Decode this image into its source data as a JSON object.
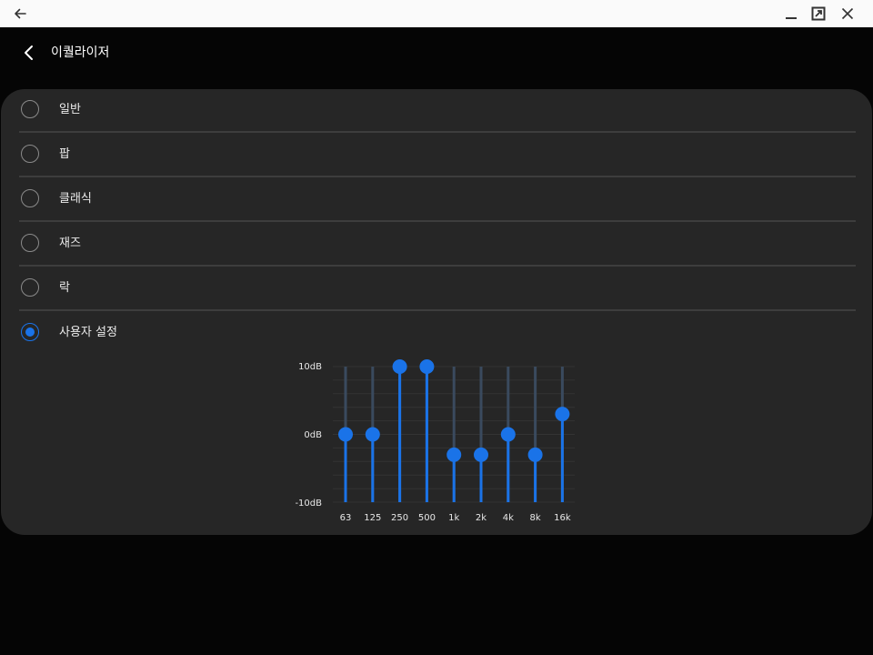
{
  "window": {
    "back_icon": "arrow-left-icon",
    "minimize_icon": "minimize-icon",
    "maximize_icon": "expand-icon",
    "close_icon": "close-icon"
  },
  "header": {
    "back_icon": "chevron-left-icon",
    "title": "이퀄라이저"
  },
  "presets": [
    {
      "label": "일반",
      "selected": false
    },
    {
      "label": "팝",
      "selected": false
    },
    {
      "label": "클래식",
      "selected": false
    },
    {
      "label": "재즈",
      "selected": false
    },
    {
      "label": "락",
      "selected": false
    },
    {
      "label": "사용자 설정",
      "selected": true
    }
  ],
  "equalizer": {
    "y_labels": {
      "top": "10dB",
      "mid": "0dB",
      "bottom": "-10dB"
    },
    "ylim": [
      -10,
      10
    ],
    "bands": [
      "63",
      "125",
      "250",
      "500",
      "1k",
      "2k",
      "4k",
      "8k",
      "16k"
    ],
    "gains_db": [
      0,
      0,
      10,
      10,
      -3,
      -3,
      0,
      -3,
      3
    ]
  },
  "colors": {
    "accent": "#1a73e8",
    "slider_fill": "#1a73e8",
    "track": "#3a4a5e",
    "card_bg": "#262626",
    "background": "#050505"
  }
}
